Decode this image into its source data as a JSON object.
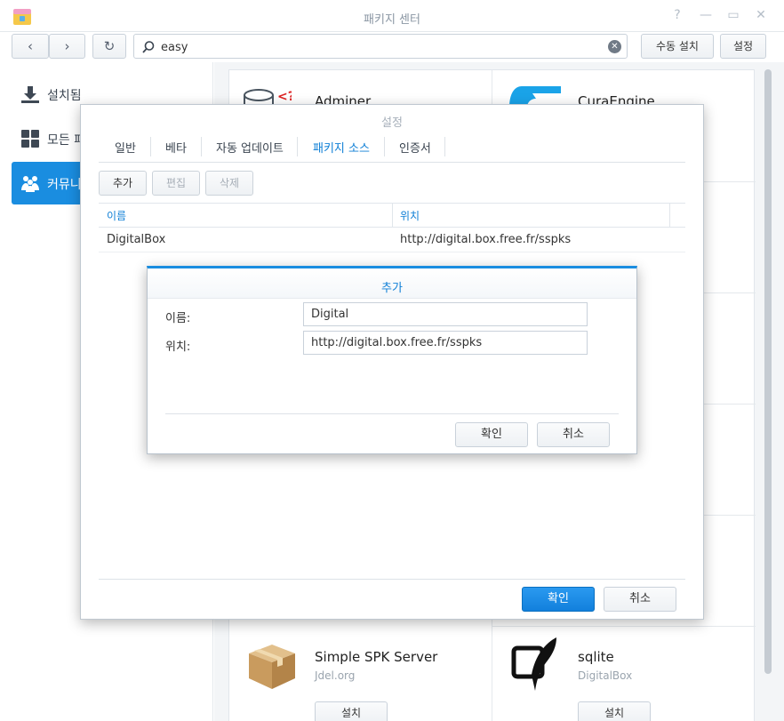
{
  "window": {
    "title": "패키지 센터",
    "help_glyph": "?",
    "min_glyph": "—",
    "max_glyph": "▭",
    "close_glyph": "✕"
  },
  "toolbar": {
    "back_glyph": "‹",
    "forward_glyph": "›",
    "refresh_glyph": "↻",
    "search_value": "easy",
    "clear_glyph": "✕",
    "manual_install": "수동 설치",
    "settings": "설정"
  },
  "sidebar": {
    "items": [
      {
        "label": "설치됨",
        "icon": "download-icon"
      },
      {
        "label": "모든 패",
        "icon": "grid-icon"
      },
      {
        "label": "커뮤니",
        "icon": "community-icon"
      }
    ]
  },
  "packages": [
    {
      "title": "Adminer",
      "subtitle": "",
      "icon": "adminer-icon"
    },
    {
      "title": "CuraEngine",
      "subtitle": "",
      "icon": "curaengine-icon"
    },
    {
      "title": "Simple SPK Server",
      "subtitle": "Jdel.org",
      "icon": "package-box-icon",
      "install": "설치"
    },
    {
      "title": "sqlite",
      "subtitle": "DigitalBox",
      "icon": "sqlite-feather-icon",
      "install": "설치"
    }
  ],
  "settings_dialog": {
    "title": "설정",
    "tabs": [
      "일반",
      "베타",
      "자동 업데이트",
      "패키지 소스",
      "인증서"
    ],
    "active_tab": "패키지 소스",
    "actions": {
      "add": "추가",
      "edit": "편집",
      "delete": "삭제"
    },
    "columns": {
      "name": "이름",
      "location": "위치"
    },
    "rows": [
      {
        "name": "DigitalBox",
        "location": "http://digital.box.free.fr/sspks"
      }
    ],
    "ok": "확인",
    "cancel": "취소"
  },
  "add_dialog": {
    "title": "추가",
    "name_label": "이름:",
    "name_value": "Digital",
    "location_label": "위치:",
    "location_value": "http://digital.box.free.fr/sspks",
    "ok": "확인",
    "cancel": "취소"
  },
  "colors": {
    "accent": "#1a8de0",
    "link_blue": "#0f7fd6"
  }
}
